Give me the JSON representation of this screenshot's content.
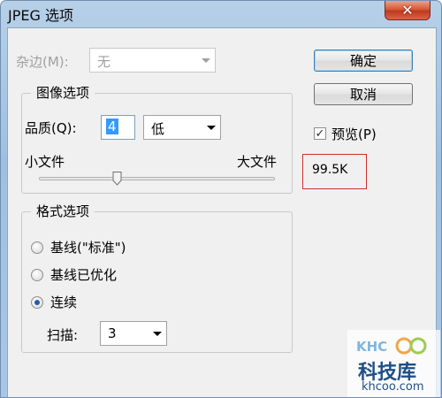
{
  "window": {
    "title": "JPEG 选项",
    "close_glyph": "✕"
  },
  "matte": {
    "label": "杂边(M):",
    "value": "无",
    "enabled": false
  },
  "image_options": {
    "title": "图像选项",
    "quality_label": "品质(Q):",
    "quality_value": "4",
    "quality_level": "低",
    "slider_min_label": "小文件",
    "slider_max_label": "大文件",
    "slider_fraction": 0.33
  },
  "format_options": {
    "title": "格式选项",
    "options": [
      {
        "label": "基线(\"标准\")",
        "selected": false
      },
      {
        "label": "基线已优化",
        "selected": false
      },
      {
        "label": "连续",
        "selected": true
      }
    ],
    "scan_label": "扫描:",
    "scan_value": "3"
  },
  "buttons": {
    "ok": "确定",
    "cancel": "取消"
  },
  "preview": {
    "label": "预览(P)",
    "checked": true,
    "check_glyph": "✓",
    "size": "99.5K"
  },
  "watermark": {
    "logo": "KHCoo",
    "name": "科技库",
    "url": "khcoo.com"
  },
  "colors": {
    "highlight_border": "#d03030",
    "title_bar": "#b7d0e8",
    "close_button": "#c0391b"
  },
  "icons": {
    "close": "close-icon",
    "dropdown": "chevron-down-icon",
    "slider": "slider-thumb-icon",
    "check": "check-icon"
  }
}
